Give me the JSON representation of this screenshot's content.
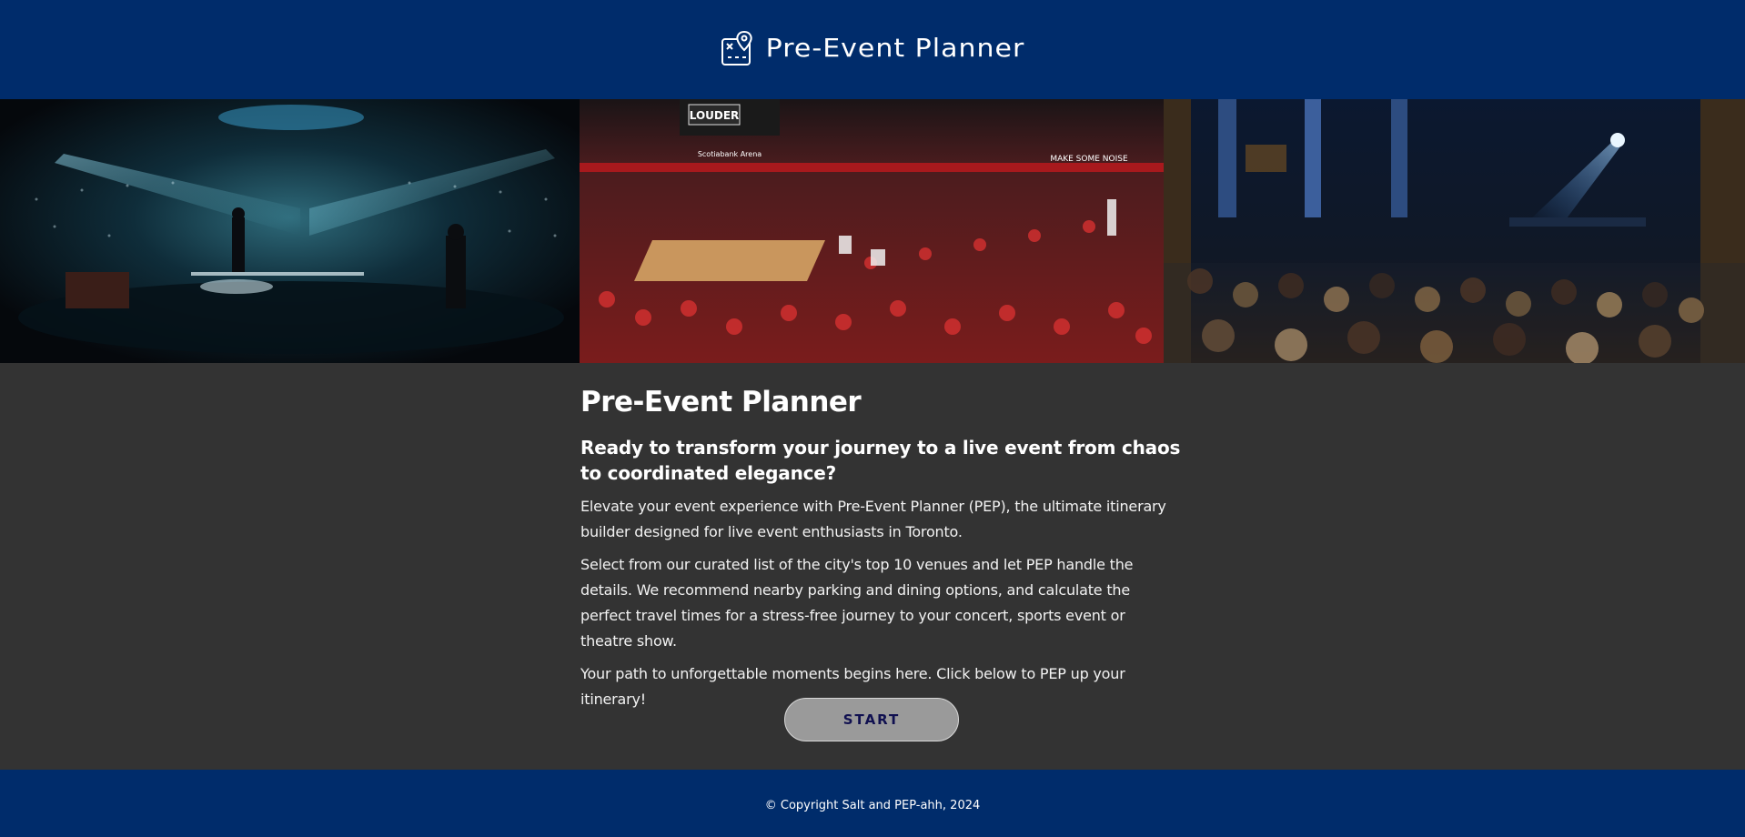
{
  "header": {
    "brand": "Pre-Event Planner",
    "logo_icon": "map-pin-icon"
  },
  "banner": {
    "images": [
      {
        "subject": "concert-stage-image",
        "caption_signage": ""
      },
      {
        "subject": "basketball-arena-image",
        "caption_signage": "LOUDER"
      },
      {
        "subject": "theatre-audience-image",
        "caption_signage": ""
      }
    ],
    "arena_signage": [
      "LOUDER",
      "Scotiabank Arena",
      "MAKE SOME NOISE"
    ]
  },
  "main": {
    "title": "Pre-Event Planner",
    "tagline": "Ready to transform your journey to a live event from chaos to coordinated elegance?",
    "paragraphs": [
      "Elevate your event experience with Pre-Event Planner (PEP), the ultimate itinerary builder designed for live event enthusiasts in Toronto.",
      "Select from our curated list of the city's top 10 venues and let PEP handle the details. We recommend nearby parking and dining options, and calculate the perfect travel times for a stress-free journey to your concert, sports event or theatre show.",
      "Your path to unforgettable moments begins here. Click below to PEP up your itinerary!"
    ],
    "start_label": "START"
  },
  "footer": {
    "copyright": "© Copyright Salt and PEP-ahh, 2024"
  },
  "colors": {
    "header_bg": "#002c6b",
    "body_bg": "#333333",
    "button_bg": "#9a9a9a",
    "button_text": "#101050"
  }
}
